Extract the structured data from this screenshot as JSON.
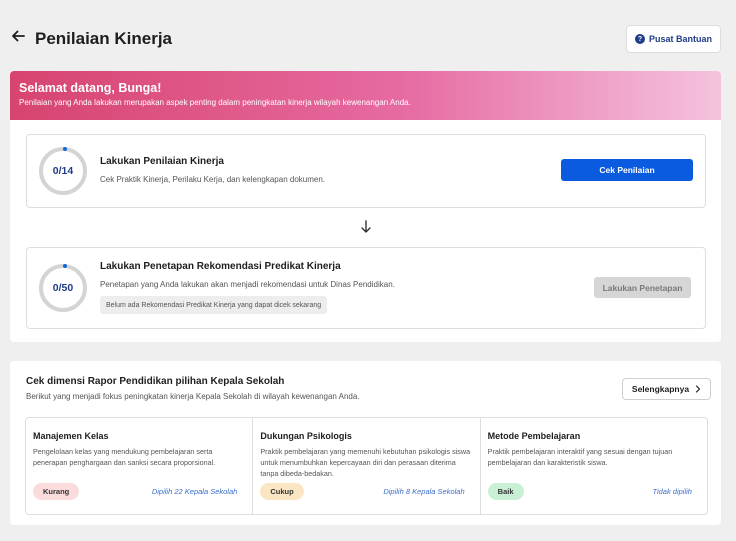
{
  "header": {
    "title": "Penilaian Kinerja",
    "help_label": "Pusat Bantuan",
    "help_icon": "question-circle-icon"
  },
  "banner": {
    "greeting": "Selamat datang, Bunga!",
    "subtitle": "Penilaian yang Anda lakukan merupakan aspek penting dalam peningkatan kinerja wilayah kewenangan Anda."
  },
  "steps": [
    {
      "progress": "0/14",
      "title": "Lakukan Penilaian Kinerja",
      "desc": "Cek Praktik Kinerja, Perilaku Kerja, dan kelengkapan dokumen.",
      "button": "Cek Penilaian"
    },
    {
      "progress": "0/50",
      "title": "Lakukan Penetapan Rekomendasi Predikat Kinerja",
      "desc": "Penetapan yang Anda lakukan akan menjadi rekomendasi untuk Dinas Pendidikan.",
      "note": "Belum ada Rekomendasi Predikat Kinerja yang dapat dicek sekarang",
      "button": "Lakukan Penetapan"
    }
  ],
  "dimensions": {
    "title": "Cek dimensi Rapor Pendidikan pilihan Kepala Sekolah",
    "subtitle": "Berikut yang menjadi fokus peningkatan kinerja Kepala Sekolah di wilayah kewenangan Anda.",
    "more_label": "Selengkapnya",
    "items": [
      {
        "title": "Manajemen Kelas",
        "desc": "Pengelolaan kelas yang mendukung pembelajaran serta penerapan penghargaan dan sanksi secara proporsional.",
        "badge": "Kurang",
        "badge_color": "#fbdcdc",
        "chosen": "Dipilih 22 Kepala Sekolah"
      },
      {
        "title": "Dukungan Psikologis",
        "desc": "Praktik pembelajaran yang memenuhi kebutuhan psikologis siswa untuk menumbuhkan kepercayaan diri dan perasaan diterima tanpa dibeda-bedakan.",
        "badge": "Cukup",
        "badge_color": "#fbe6c4",
        "chosen": "Dipilih 8 Kepala Sekolah"
      },
      {
        "title": "Metode Pembelajaran",
        "desc": "Praktik pembelajaran interaktif yang sesuai dengan tujuan pembelajaran dan karakteristik siswa.",
        "badge": "Baik",
        "badge_color": "#c9efd4",
        "chosen": "Tidak dipilih"
      }
    ]
  },
  "colors": {
    "primary": "#0b5be0",
    "banner_start": "#d7446f",
    "banner_end": "#f5c3dd",
    "progress_text": "#1f3c88"
  }
}
